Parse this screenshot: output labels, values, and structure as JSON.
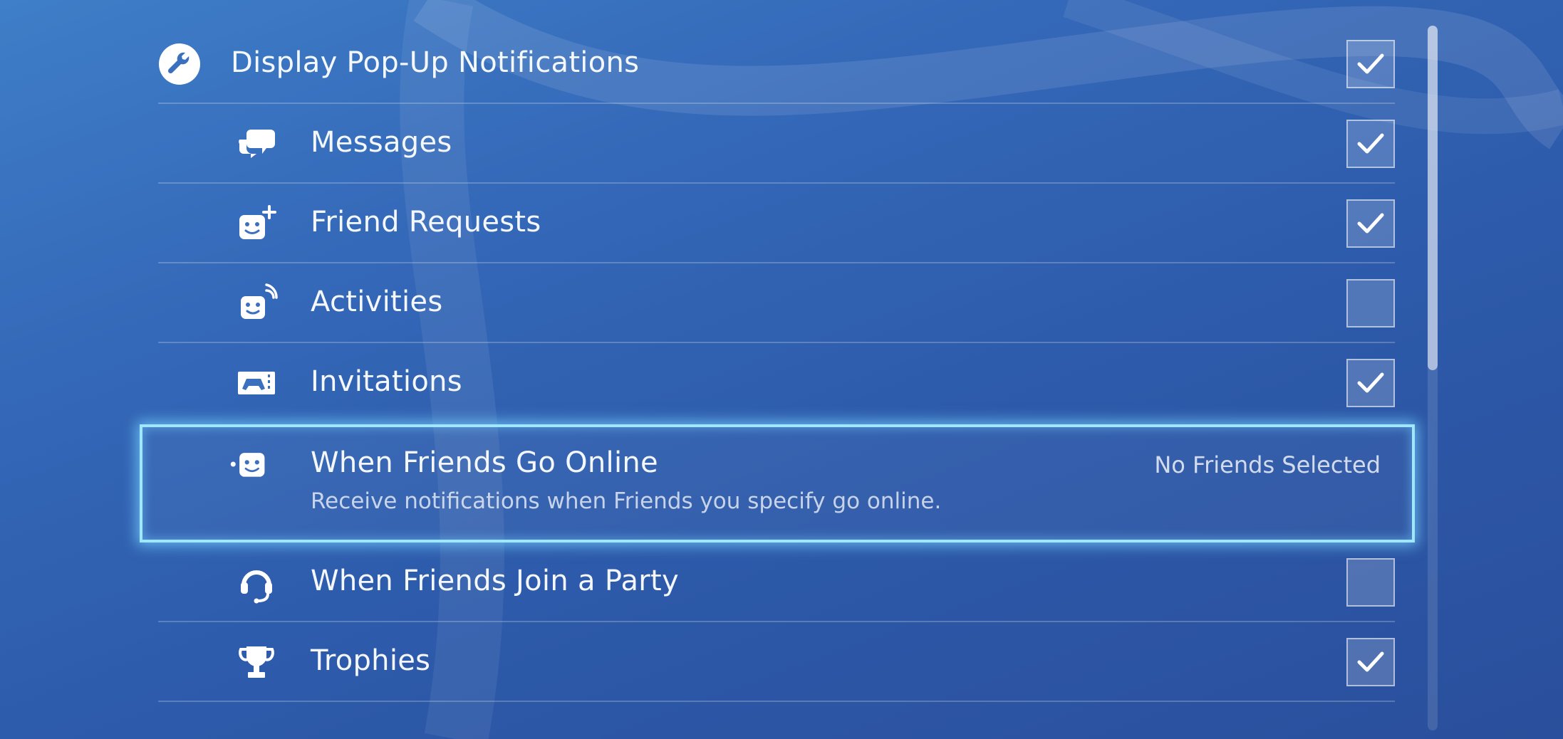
{
  "settings": {
    "items": [
      {
        "label": "Display Pop-Up Notifications",
        "icon": "wrench-icon",
        "checked": true
      },
      {
        "label": "Messages",
        "icon": "speech-bubbles-icon",
        "checked": true
      },
      {
        "label": "Friend Requests",
        "icon": "friend-add-icon",
        "checked": true
      },
      {
        "label": "Activities",
        "icon": "friend-activity-icon",
        "checked": false
      },
      {
        "label": "Invitations",
        "icon": "game-invite-icon",
        "checked": true
      },
      {
        "label": "When Friends Go Online",
        "icon": "friend-online-icon",
        "value": "No Friends Selected",
        "description": "Receive notifications when Friends you specify go online."
      },
      {
        "label": "When Friends Join a Party",
        "icon": "headset-icon",
        "checked": false
      },
      {
        "label": "Trophies",
        "icon": "trophy-icon",
        "checked": true
      }
    ]
  },
  "colors": {
    "focus_border": "#9fe6ff",
    "background": "#3468b8"
  }
}
